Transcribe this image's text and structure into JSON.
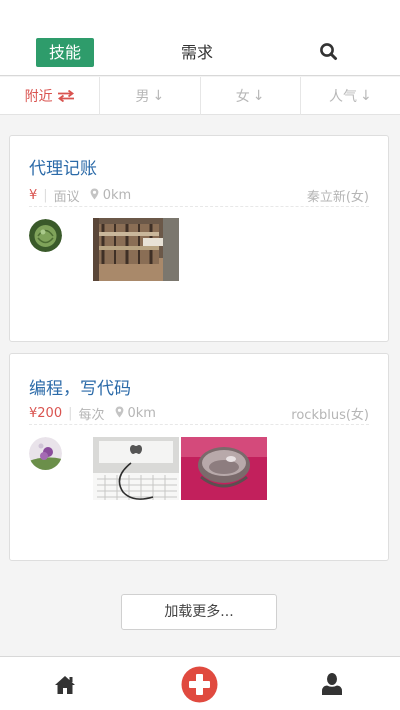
{
  "header": {
    "segments": [
      {
        "label": "技能",
        "active": true
      },
      {
        "label": "需求",
        "active": false
      }
    ],
    "search_icon": "search-icon"
  },
  "filters": [
    {
      "label": "附近",
      "icon": "swap-arrows-icon",
      "active": true
    },
    {
      "label": "男",
      "icon": "sort-down-icon",
      "active": false
    },
    {
      "label": "女",
      "icon": "sort-down-icon",
      "active": false
    },
    {
      "label": "人气",
      "icon": "sort-down-icon",
      "active": false
    }
  ],
  "cards": [
    {
      "title": "代理记账",
      "price": "¥",
      "unit": "面议",
      "distance": "0km",
      "author": "秦立新(女)",
      "avatar": "green-melon-avatar",
      "images": [
        "wooden-cart-photo"
      ]
    },
    {
      "title": "编程，写代码",
      "price": "¥200",
      "unit": "每次",
      "distance": "0km",
      "author": "rockblus(女)",
      "avatar": "purple-flower-avatar",
      "images": [
        "computer-keyboard-photo",
        "pink-bowl-photo"
      ]
    }
  ],
  "load_more": "加载更多...",
  "colors": {
    "accent_green": "#2e9c6b",
    "accent_red": "#d9534f",
    "title_blue": "#2b6aa8",
    "icon_dark": "#333333"
  },
  "bottom_nav": [
    {
      "icon": "home-icon"
    },
    {
      "icon": "add-plus-icon"
    },
    {
      "icon": "user-icon"
    }
  ]
}
